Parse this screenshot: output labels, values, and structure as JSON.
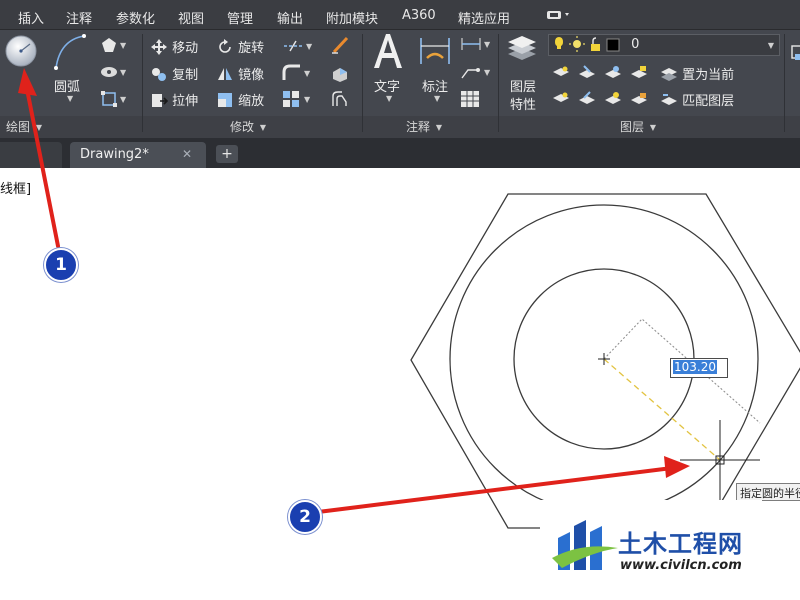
{
  "menu": {
    "tabs": [
      {
        "label": "插入"
      },
      {
        "label": "注释"
      },
      {
        "label": "参数化"
      },
      {
        "label": "视图"
      },
      {
        "label": "管理"
      },
      {
        "label": "输出"
      },
      {
        "label": "附加模块"
      },
      {
        "label": "A360"
      },
      {
        "label": "精选应用"
      }
    ]
  },
  "ribbon": {
    "draw": {
      "title": "绘图",
      "circle_icon": "circle-icon",
      "arc_label": "圆弧"
    },
    "modify": {
      "title": "修改",
      "move": "移动",
      "rotate": "旋转",
      "copy": "复制",
      "mirror": "镜像",
      "stretch": "拉伸",
      "scale": "缩放"
    },
    "annotation": {
      "title": "注释",
      "text": "文字",
      "dimension": "标注"
    },
    "layers": {
      "title": "图层",
      "properties_line1": "图层",
      "properties_line2": "特性",
      "current_layer": "0",
      "set_current": "置为当前",
      "match_layer": "匹配图层"
    }
  },
  "files": {
    "active_tab": "Drawing2*",
    "left_tab_fragment": ""
  },
  "canvas": {
    "viewport_label": "线框]",
    "dimension_value": "103.20",
    "tooltip": "指定圆的半径"
  },
  "callouts": {
    "one": "1",
    "two": "2"
  },
  "watermark": {
    "brand": "土木工程网",
    "url": "www.civilcn.com"
  },
  "colors": {
    "ribbon_bg": "#44474e",
    "menubar_bg": "#3b3d42",
    "callout_arrow": "#e0221b",
    "callout_badge": "#1a3fb0",
    "dimension_highlight": "#3a7fd8",
    "tracking_line": "#e2c341"
  }
}
